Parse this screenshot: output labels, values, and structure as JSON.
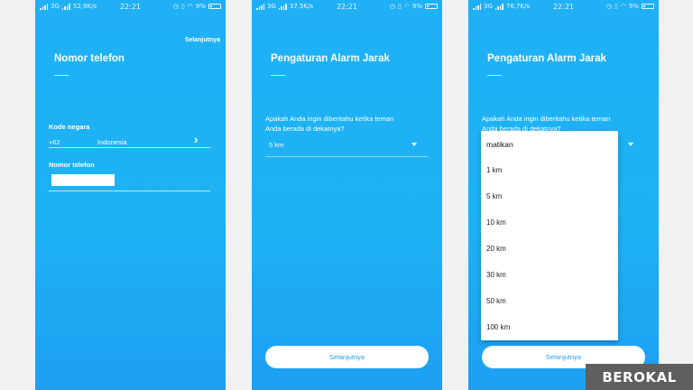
{
  "screens": [
    {
      "status": {
        "network": "3G",
        "speed": "52,9K/s",
        "time": "22:21",
        "battery": "9%"
      },
      "next_label": "Selanjutnya",
      "title": "Nomor telefon",
      "country_code_label": "Kode negara",
      "country_code": "+62",
      "country_name": "Indonesia",
      "phone_label": "Nomor telefon",
      "phone_value": ""
    },
    {
      "status": {
        "network": "3G",
        "speed": "37,5K/s",
        "time": "22:21",
        "battery": "9%"
      },
      "title": "Pengaturan Alarm Jarak",
      "question_line1": "Apakah Anda ingin diberitahu ketika teman",
      "question_line2": "Anda berada di dekatnya?",
      "selected": "5 km",
      "button_label": "Selanjutnya"
    },
    {
      "status": {
        "network": "3G",
        "speed": "76,7K/s",
        "time": "22:21",
        "battery": "9%"
      },
      "title": "Pengaturan Alarm Jarak",
      "question_line1": "Apakah Anda ingin diberitahu ketika teman",
      "question_line2": "Anda berada di dekatnya?",
      "options": [
        "matikan",
        "1 km",
        "5 km",
        "10 km",
        "20 km",
        "30 km",
        "50 km",
        "100 km"
      ],
      "button_label": "Selanjutnya"
    }
  ],
  "watermark": "BEROKAL",
  "colors": {
    "background": "#1db3f3",
    "button_text": "#2aa0e6"
  },
  "icons": [
    "signal-icon",
    "wifi-icon",
    "alarm-icon",
    "vibrate-icon",
    "battery-icon",
    "chevron-right-icon",
    "dropdown-arrow-icon"
  ]
}
